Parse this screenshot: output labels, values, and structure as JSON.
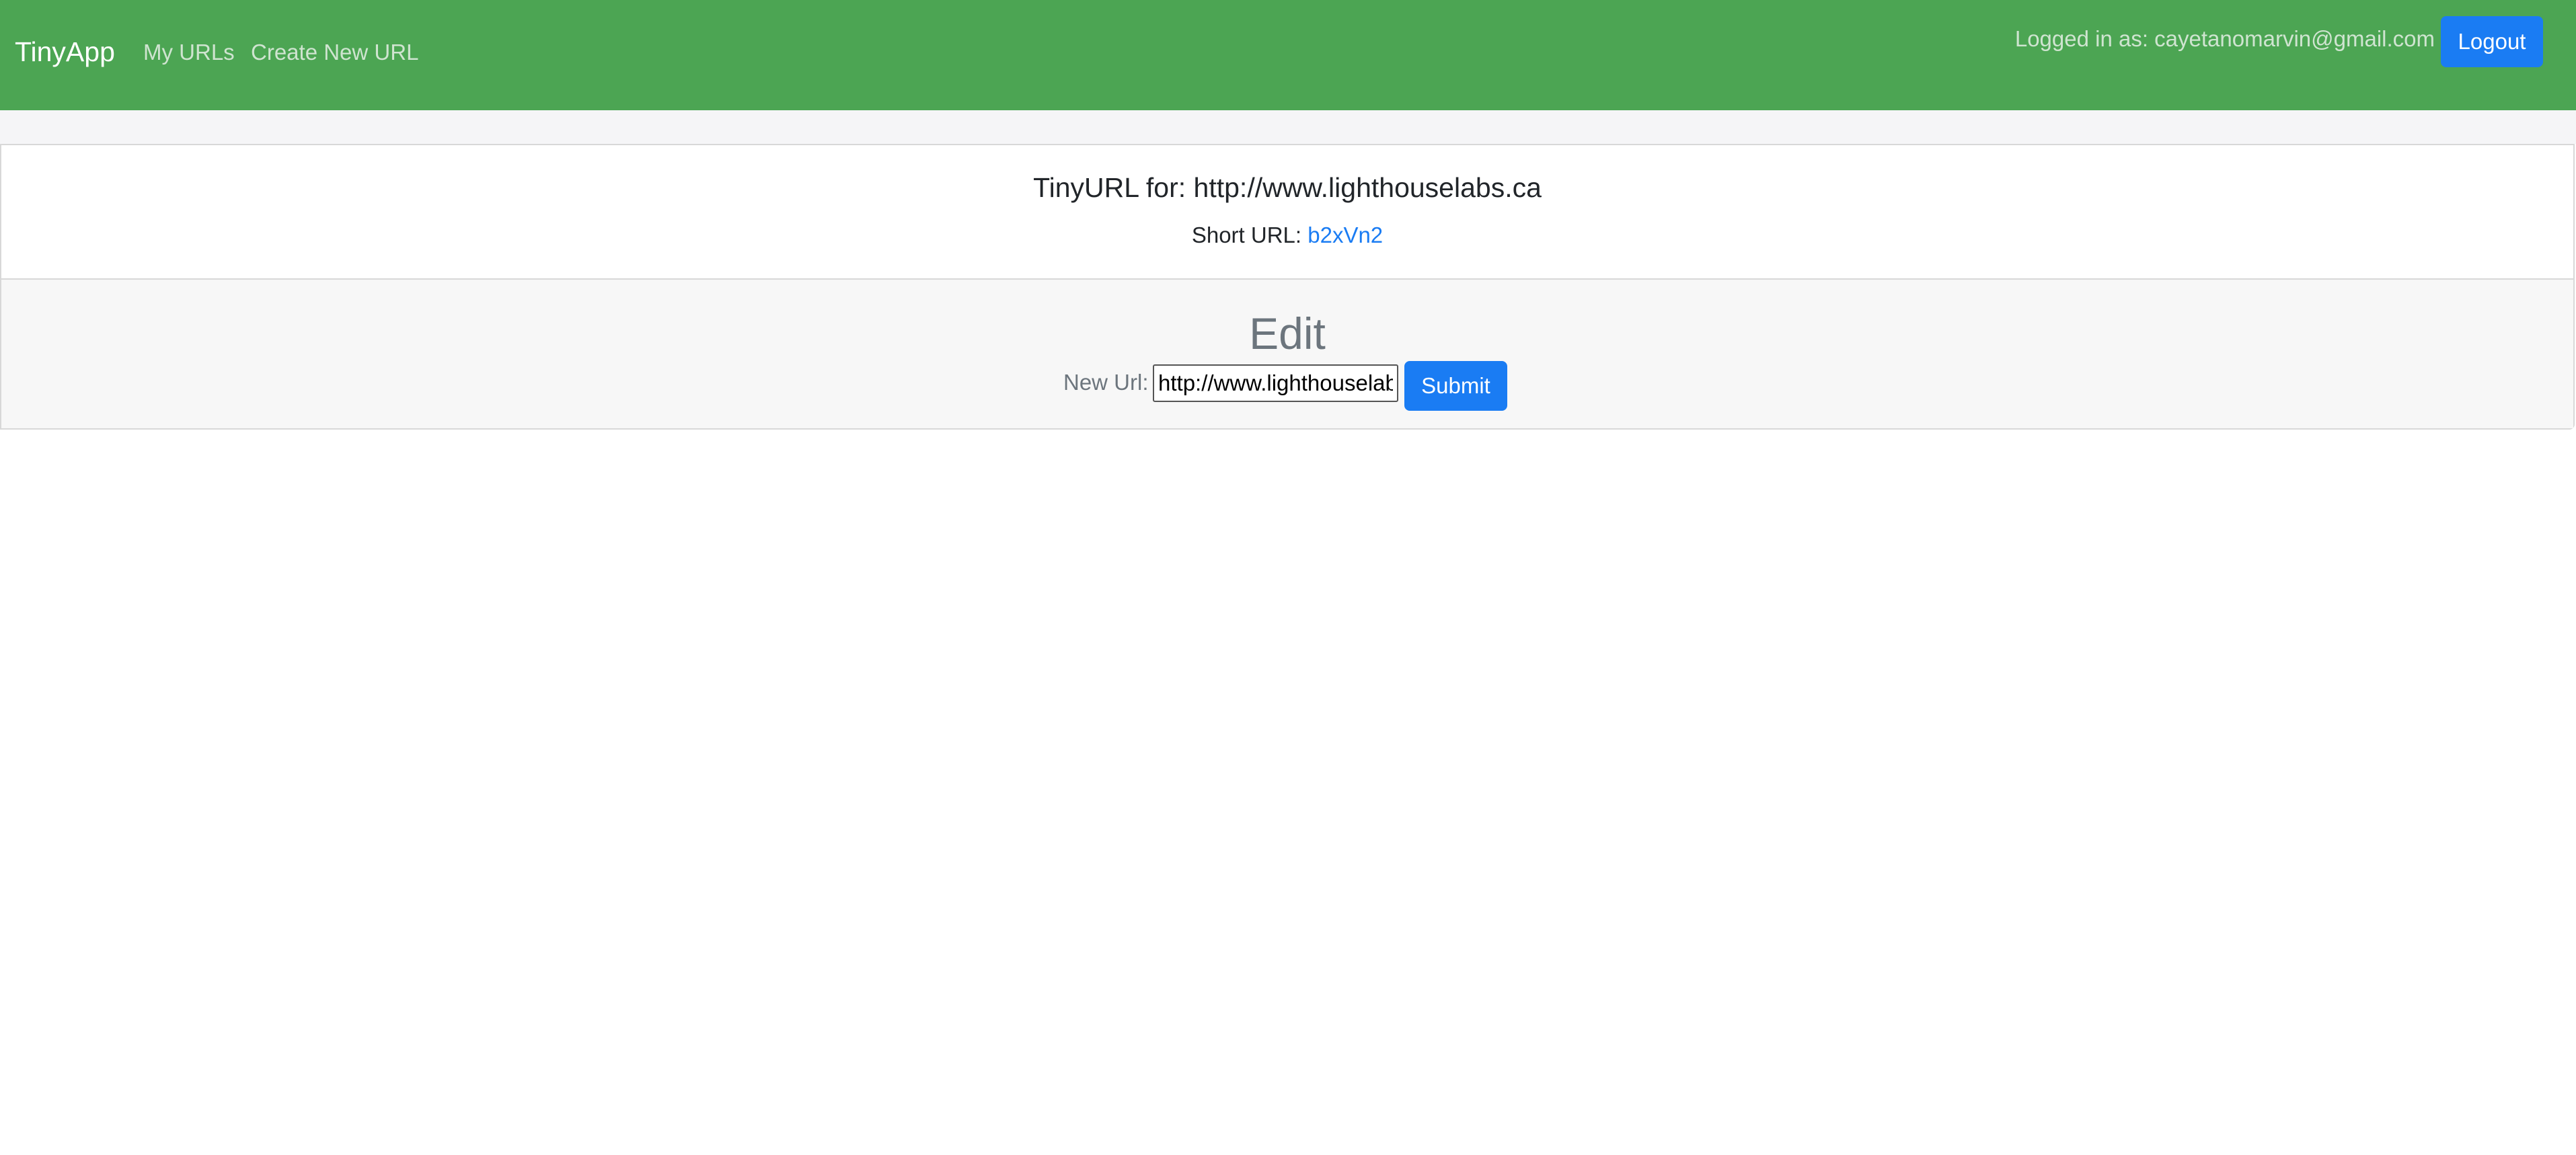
{
  "navbar": {
    "brand": "TinyApp",
    "links": [
      {
        "label": "My URLs"
      },
      {
        "label": "Create New URL"
      }
    ],
    "logged_in_text": "Logged in as: cayetanomarvin@gmail.com",
    "logout_label": "Logout",
    "background_color": "#4ca553"
  },
  "card": {
    "title": "TinyURL for: http://www.lighthouselabs.ca",
    "short_url_label": "Short URL: ",
    "short_url_value": "b2xVn2"
  },
  "edit": {
    "heading": "Edit",
    "new_url_label": "New Url:",
    "input_value": "http://www.lighthouselabs.ca",
    "submit_label": "Submit"
  },
  "colors": {
    "primary_button": "#1a7cf3",
    "link": "#1a7cf3",
    "muted_text": "#6c757d"
  }
}
